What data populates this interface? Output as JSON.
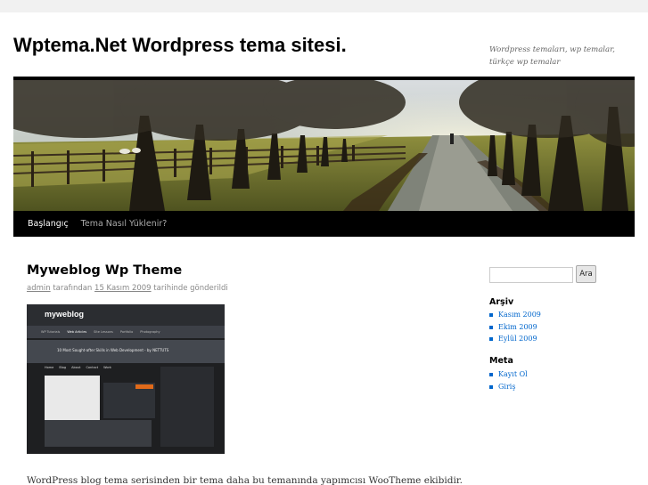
{
  "site": {
    "title": "Wptema.Net Wordpress tema sitesi.",
    "description": "Wordpress temaları, wp temalar, türkçe wp temalar"
  },
  "nav": {
    "items": [
      "Başlangıç",
      "Tema Nasıl Yüklenir?"
    ]
  },
  "post": {
    "title": "Myweblog Wp Theme",
    "meta_author": "admin",
    "meta_by": "tarafından",
    "meta_date": "15 Kasım 2009",
    "meta_posted": "tarihinde gönderildi",
    "excerpt": "WordPress blog tema serisinden bir tema daha bu temanında yapımcısı WooTheme ekibidir.",
    "thumbnail": {
      "logo": "myweblog",
      "heading": "10 Most Sought-after Skills in Web Development - by NETTUTS",
      "nav": [
        "WP Tutorials",
        "Web Articles",
        "Site Lessons",
        "Portfolio",
        "Photography"
      ],
      "tabs": [
        "Home",
        "Blog",
        "About",
        "Contact",
        "Work"
      ]
    }
  },
  "sidebar": {
    "search_button": "Ara",
    "search_placeholder": "",
    "archive_title": "Arşiv",
    "archive_items": [
      "Kasım 2009",
      "Ekim 2009",
      "Eylül 2009"
    ],
    "meta_title": "Meta",
    "meta_items": [
      "Kayıt Ol",
      "Giriş"
    ]
  },
  "colors": {
    "page_background": "#f1f1f1",
    "nav_background": "#000000",
    "link": "#0066cc"
  }
}
